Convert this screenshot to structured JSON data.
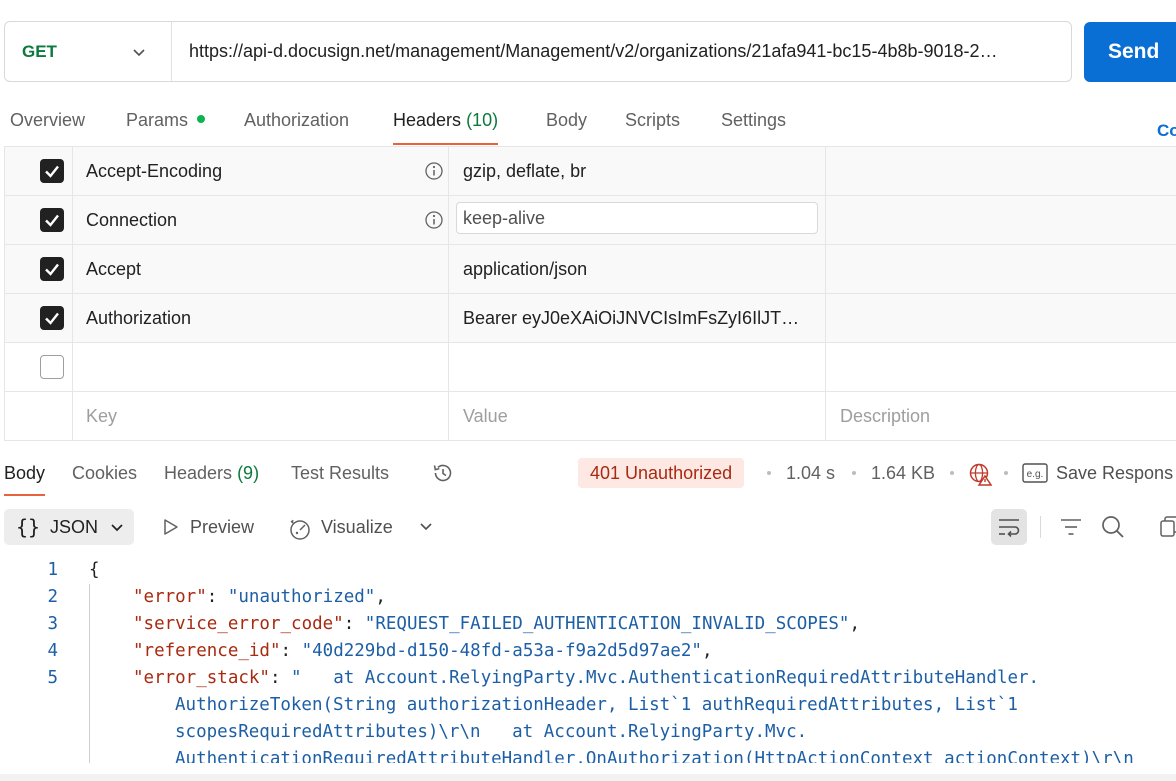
{
  "request": {
    "method": "GET",
    "url": "https://api-d.docusign.net/management/Management/v2/organizations/21afa941-bc15-4b8b-9018-2…",
    "send_label": "Send"
  },
  "request_tabs": [
    {
      "label": "Overview"
    },
    {
      "label": "Params"
    },
    {
      "label": "Authorization"
    },
    {
      "label": "Headers",
      "count": "(10)"
    },
    {
      "label": "Body"
    },
    {
      "label": "Scripts"
    },
    {
      "label": "Settings"
    }
  ],
  "cookies_link": "Co",
  "headers": {
    "rows": [
      {
        "key": "Accept-Encoding",
        "value": "gzip, deflate, br",
        "checked": true
      },
      {
        "key": "Connection",
        "value": "keep-alive",
        "checked": true
      },
      {
        "key": "Accept",
        "value": "application/json",
        "checked": true
      },
      {
        "key": "Authorization",
        "value": "Bearer eyJ0eXAiOiJNVCIsImFsZyI6IlJT…",
        "checked": true
      }
    ],
    "placeholders": {
      "key": "Key",
      "value": "Value",
      "description": "Description"
    }
  },
  "response": {
    "tabs": [
      {
        "label": "Body"
      },
      {
        "label": "Cookies"
      },
      {
        "label": "Headers",
        "count": "(9)"
      },
      {
        "label": "Test Results"
      }
    ],
    "status": "401 Unauthorized",
    "time": "1.04 s",
    "size": "1.64 KB",
    "save_label": "Save Respons",
    "status_color": "#a82a10"
  },
  "body_toolbar": {
    "format": "JSON",
    "preview": "Preview",
    "visualize": "Visualize"
  },
  "code_lines": {
    "numbers": [
      "1",
      "2",
      "3",
      "4",
      "5"
    ],
    "l1": "{",
    "l2_key": "\"error\"",
    "l2_val": "\"unauthorized\"",
    "l3_key": "\"service_error_code\"",
    "l3_val": "\"REQUEST_FAILED_AUTHENTICATION_INVALID_SCOPES\"",
    "l4_key": "\"reference_id\"",
    "l4_val": "\"40d229bd-d150-48fd-a53a-f9a2d5d97ae2\"",
    "l5_key": "\"error_stack\"",
    "l5_val_a": "\"   at Account.RelyingParty.Mvc.AuthenticationRequiredAttributeHandler.",
    "l5_val_b": "AuthorizeToken(String authorizationHeader, List`1 authRequiredAttributes, List`1",
    "l5_val_c": "scopesRequiredAttributes)\\r\\n   at Account.RelyingParty.Mvc.",
    "l5_val_d": "AuthenticationRequiredAttributeHandler.OnAuthorization(HttpActionContext actionContext)\\r\\n"
  },
  "colors": {
    "send_button": "#0a6fd4",
    "method_get": "#0b7a3d",
    "active_tab_underline": "#e8623d",
    "status_badge_bg": "#fde8e4",
    "json_key": "#a82a10",
    "json_string": "#1d5fa6"
  },
  "icons": [
    "chevron-down-icon",
    "info-icon",
    "checkbox-checked-icon",
    "history-icon",
    "globe-warning-icon",
    "save-example-icon",
    "play-icon",
    "visualize-icon",
    "wrap-lines-icon",
    "filter-icon",
    "search-icon",
    "copy-icon"
  ]
}
